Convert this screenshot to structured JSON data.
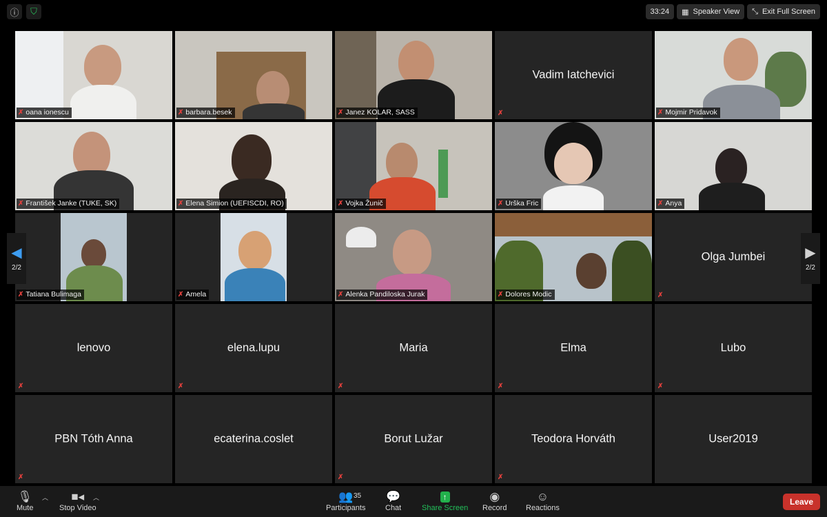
{
  "topbar": {
    "info_icon": "info-icon",
    "shield_icon": "shield-icon",
    "timer": "33:24",
    "speaker_view_label": "Speaker View",
    "exit_fullscreen_label": "Exit Full Screen"
  },
  "pager": {
    "left_page": "2/2",
    "right_page": "2/2"
  },
  "colors": {
    "muted": "#e0403c",
    "leave": "#c8322b",
    "share": "#22b14c",
    "tile": "#252525"
  },
  "participants": [
    {
      "name": "oana ionescu",
      "video": true
    },
    {
      "name": "barbara.besek",
      "video": true
    },
    {
      "name": "Janez KOLAR, SASS",
      "video": true
    },
    {
      "name": "Vadim Iatchevici",
      "video": false
    },
    {
      "name": "Mojmir Pridavok",
      "video": true
    },
    {
      "name": "František Janke (TUKE, SK)",
      "video": true
    },
    {
      "name": "Elena Simion (UEFISCDI, RO)",
      "video": true
    },
    {
      "name": "Vojka Žunič",
      "video": true
    },
    {
      "name": "Urška Fric",
      "video": true
    },
    {
      "name": "Anya",
      "video": true
    },
    {
      "name": "Tatiana Bulimaga",
      "video": true
    },
    {
      "name": "Amela",
      "video": true
    },
    {
      "name": "Alenka Pandiloska Jurak",
      "video": true
    },
    {
      "name": "Dolores Modic",
      "video": true
    },
    {
      "name": "Olga Jumbei",
      "video": false
    },
    {
      "name": "lenovo",
      "video": false
    },
    {
      "name": "elena.lupu",
      "video": false
    },
    {
      "name": "Maria",
      "video": false
    },
    {
      "name": "Elma",
      "video": false
    },
    {
      "name": "Lubo",
      "video": false
    },
    {
      "name": "PBN Tóth Anna",
      "video": false
    },
    {
      "name": "ecaterina.coslet",
      "video": false
    },
    {
      "name": "Borut Lužar",
      "video": false
    },
    {
      "name": "Teodora Horváth",
      "video": false
    },
    {
      "name": "User2019",
      "video": false
    }
  ],
  "toolbar": {
    "mute_label": "Mute",
    "stop_video_label": "Stop Video",
    "participants_label": "Participants",
    "participants_count": "35",
    "chat_label": "Chat",
    "share_screen_label": "Share Screen",
    "record_label": "Record",
    "reactions_label": "Reactions",
    "leave_label": "Leave"
  }
}
